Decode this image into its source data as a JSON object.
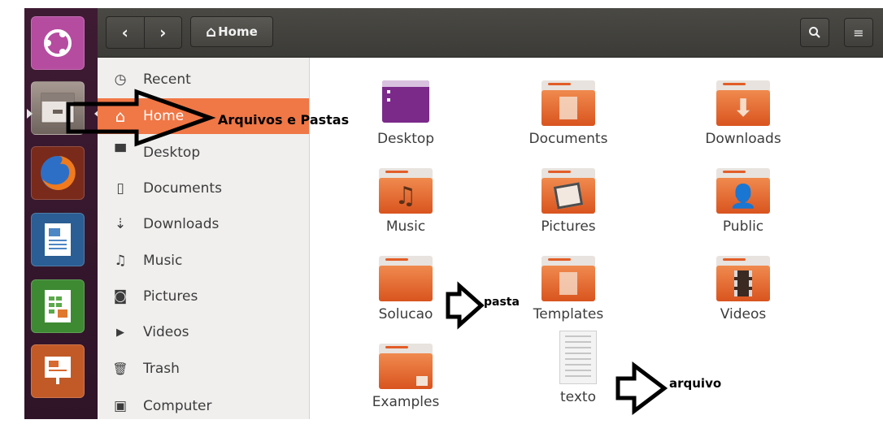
{
  "header": {
    "back_glyph": "‹",
    "forward_glyph": "›",
    "location_label": "Home",
    "search_glyph": "🔍",
    "view_glyph": "≡"
  },
  "launcher": {
    "items": [
      {
        "icon": "ubuntu-dash-icon",
        "color": "#b54ca0"
      },
      {
        "icon": "files-icon",
        "color": "#8b7c74"
      },
      {
        "icon": "firefox-icon",
        "color": "#e46a21"
      },
      {
        "icon": "libreoffice-writer-icon",
        "color": "#3a6ea5"
      },
      {
        "icon": "libreoffice-calc-icon",
        "color": "#4b9a3d"
      },
      {
        "icon": "libreoffice-impress-icon",
        "color": "#d0632b"
      }
    ]
  },
  "sidebar": {
    "items": [
      {
        "label": "Recent",
        "icon": "clock-icon",
        "glyph": "◷"
      },
      {
        "label": "Home",
        "icon": "home-icon",
        "glyph": "⌂"
      },
      {
        "label": "Desktop",
        "icon": "desktop-folder-icon",
        "glyph": "▀"
      },
      {
        "label": "Documents",
        "icon": "document-icon",
        "glyph": "▯"
      },
      {
        "label": "Downloads",
        "icon": "download-icon",
        "glyph": "⇣"
      },
      {
        "label": "Music",
        "icon": "music-icon",
        "glyph": "♫"
      },
      {
        "label": "Pictures",
        "icon": "camera-icon",
        "glyph": "◙"
      },
      {
        "label": "Videos",
        "icon": "video-icon",
        "glyph": "▶"
      },
      {
        "label": "Trash",
        "icon": "trash-icon",
        "glyph": "🗑"
      },
      {
        "label": "Computer",
        "icon": "computer-icon",
        "glyph": "▣"
      }
    ],
    "active_index": 1
  },
  "files": [
    {
      "label": "Desktop",
      "icon": "desktop-icon"
    },
    {
      "label": "Documents",
      "icon": "documents-folder-icon"
    },
    {
      "label": "Downloads",
      "icon": "downloads-folder-icon"
    },
    {
      "label": "Music",
      "icon": "music-folder-icon"
    },
    {
      "label": "Pictures",
      "icon": "pictures-folder-icon"
    },
    {
      "label": "Public",
      "icon": "public-folder-icon"
    },
    {
      "label": "Solucao",
      "icon": "folder-icon"
    },
    {
      "label": "Templates",
      "icon": "templates-folder-icon"
    },
    {
      "label": "Videos",
      "icon": "videos-folder-icon"
    },
    {
      "label": "Examples",
      "icon": "examples-folder-icon"
    },
    {
      "label": "texto",
      "icon": "text-file-icon"
    }
  ],
  "annotations": {
    "home_note": "Arquivos e Pastas",
    "folder_note": "pasta",
    "file_note": "arquivo"
  },
  "colors": {
    "accent": "#f07746",
    "folder": "#e8652f",
    "launcher_bg": "#3e1b33",
    "header_bg": "#3c3b37"
  }
}
